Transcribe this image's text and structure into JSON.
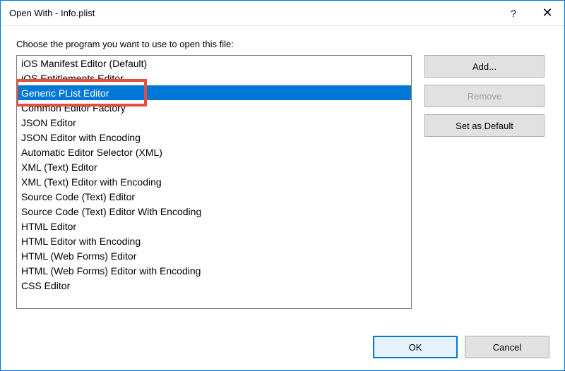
{
  "titlebar": {
    "title": "Open With - Info.plist"
  },
  "instruction": "Choose the program you want to use to open this file:",
  "list": {
    "items": [
      "iOS Manifest Editor (Default)",
      "iOS Entitlements Editor",
      "Generic PList Editor",
      "Common Editor Factory",
      "JSON Editor",
      "JSON Editor with Encoding",
      "Automatic Editor Selector (XML)",
      "XML (Text) Editor",
      "XML (Text) Editor with Encoding",
      "Source Code (Text) Editor",
      "Source Code (Text) Editor With Encoding",
      "HTML Editor",
      "HTML Editor with Encoding",
      "HTML (Web Forms) Editor",
      "HTML (Web Forms) Editor with Encoding",
      "CSS Editor"
    ],
    "selectedIndex": 2,
    "highlightIndex": 2
  },
  "sideButtons": {
    "add": "Add...",
    "remove": "Remove",
    "setDefault": "Set as Default"
  },
  "bottomButtons": {
    "ok": "OK",
    "cancel": "Cancel"
  },
  "colors": {
    "accent": "#0078d7",
    "highlight": "#e74c3c"
  }
}
